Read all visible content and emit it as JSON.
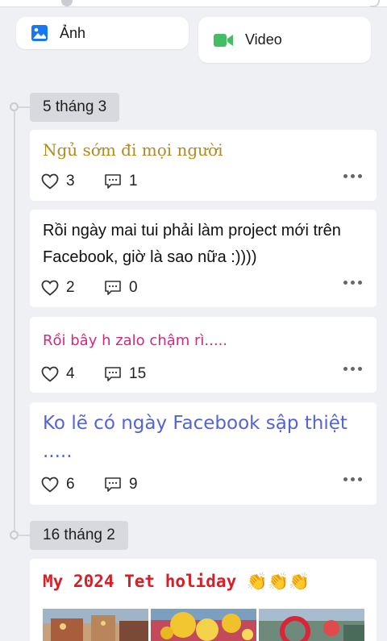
{
  "media_buttons": {
    "photo_label": "Ảnh",
    "video_label": "Video"
  },
  "timeline": [
    {
      "date": "5 tháng 3",
      "posts": [
        {
          "text": "Ngủ sớm đi mọi người",
          "likes": "3",
          "comments": "1",
          "color": "#b38a20"
        },
        {
          "text": "Rồi ngày mai tui phải làm project mới trên Facebook, giờ là sao nữa :))))",
          "likes": "2",
          "comments": "0",
          "color": "#111111"
        },
        {
          "text": "Rồi bây h zalo chậm rì.....",
          "likes": "4",
          "comments": "15",
          "color": "#d12a7c"
        },
        {
          "text": "Ko lẽ có ngày Facebook sập thiệt .....",
          "likes": "6",
          "comments": "9",
          "color": "#5464d6"
        }
      ]
    },
    {
      "date": "16 tháng 2",
      "posts": [
        {
          "text": "My 2024 Tet holiday 👏👏👏",
          "color": "#d62027"
        }
      ]
    }
  ],
  "colors": {
    "background": "#eef0f4",
    "photo_icon": "#1877f2",
    "video_icon": "#45bd62"
  },
  "icons": [
    "photo-icon",
    "video-camera-icon",
    "heart-icon",
    "comment-icon",
    "more-dots-icon"
  ]
}
